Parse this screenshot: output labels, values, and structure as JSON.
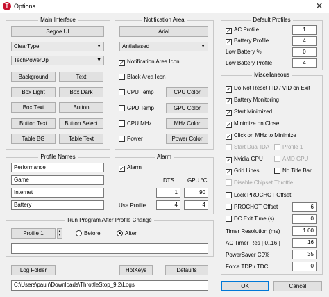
{
  "window": {
    "title": "Options",
    "app_icon_letter": "T",
    "close_glyph": "✕"
  },
  "groups": {
    "main_interface": "Main Interface",
    "notification_area": "Notification Area",
    "default_profiles": "Default Profiles",
    "profile_names": "Profile Names",
    "alarm": "Alarm",
    "run_program": "Run Program After Profile Change",
    "miscellaneous": "Miscellaneous"
  },
  "main_interface": {
    "font_button": "Segoe UI",
    "text_mode_select": "ClearType",
    "theme_select": "TechPowerUp",
    "color_buttons": [
      "Background",
      "Text",
      "Box Light",
      "Box Dark",
      "Box Text",
      "Button",
      "Button Text",
      "Button Select",
      "Table BG",
      "Table Text"
    ]
  },
  "notification_area": {
    "font_button": "Arial",
    "text_mode_select": "Antialiased",
    "notification_icon": {
      "label": "Notification Area Icon",
      "checked": true
    },
    "black_icon": {
      "label": "Black Area Icon",
      "checked": false
    },
    "rows": [
      {
        "label": "CPU Temp",
        "checked": false,
        "button": "CPU Color"
      },
      {
        "label": "GPU Temp",
        "checked": false,
        "button": "GPU Color"
      },
      {
        "label": "CPU MHz",
        "checked": false,
        "button": "MHz Color"
      },
      {
        "label": "Power",
        "checked": false,
        "button": "Power Color"
      }
    ]
  },
  "default_profiles": [
    {
      "label": "AC Profile",
      "type": "check",
      "checked": true,
      "value": "1"
    },
    {
      "label": "Battery Profile",
      "type": "check",
      "checked": true,
      "value": "4"
    },
    {
      "label": "Low Battery %",
      "type": "text",
      "value": "0"
    },
    {
      "label": "Low Battery Profile",
      "type": "text",
      "value": "4"
    }
  ],
  "profile_names": [
    "Performance",
    "Game",
    "Internet",
    "Battery"
  ],
  "alarm": {
    "label": "Alarm",
    "checked": true,
    "dts_header": "DTS",
    "gpu_header": "GPU °C",
    "dts_value": "1",
    "gpu_value": "90",
    "use_profile_label": "Use Profile",
    "use_profile_dts": "4",
    "use_profile_gpu": "4"
  },
  "run_program": {
    "profile_button": "Profile 1",
    "before_label": "Before",
    "after_label": "After",
    "selected": "after",
    "path_value": ""
  },
  "miscellaneous": {
    "checks": [
      {
        "label": "Do Not Reset FID / VID on Exit",
        "checked": true,
        "disabled": false
      },
      {
        "label": "Battery Monitoring",
        "checked": true,
        "disabled": false
      },
      {
        "label": "Start Minimized",
        "checked": true,
        "disabled": false
      },
      {
        "label": "Minimize on Close",
        "checked": true,
        "disabled": false
      },
      {
        "label": "Click on MHz to Minimize",
        "checked": true,
        "disabled": false
      }
    ],
    "pairs": [
      {
        "left": {
          "label": "Start Dual IDA",
          "checked": false,
          "disabled": true
        },
        "right": {
          "label": "Profile 1",
          "checked": false,
          "disabled": true
        }
      },
      {
        "left": {
          "label": "Nvidia GPU",
          "checked": true,
          "disabled": false
        },
        "right": {
          "label": "AMD GPU",
          "checked": false,
          "disabled": true
        }
      },
      {
        "left": {
          "label": "Grid Lines",
          "checked": true,
          "disabled": false
        },
        "right": {
          "label": "No Title Bar",
          "checked": false,
          "disabled": false
        }
      }
    ],
    "disable_chipset": {
      "label": "Disable Chipset Throttle",
      "checked": false,
      "disabled": true
    },
    "lock_prochot": {
      "label": "Lock PROCHOT Offset",
      "checked": false,
      "disabled": false
    },
    "prochot_offset": {
      "label": "PROCHOT Offset",
      "checked": false,
      "value": "6"
    },
    "dc_exit_time": {
      "label": "DC Exit Time (s)",
      "checked": false,
      "value": "0"
    },
    "timer_resolution": {
      "label": "Timer Resolution (ms)",
      "value": "1.00"
    },
    "ac_timer_res": {
      "label": "AC Timer Res [ 0..16 ]",
      "value": "16"
    },
    "powersaver": {
      "label": "PowerSaver C0%",
      "value": "35"
    },
    "force_tdp": {
      "label": "Force TDP / TDC",
      "value": "0"
    }
  },
  "footer": {
    "log_folder": "Log Folder",
    "hotkeys": "HotKeys",
    "defaults": "Defaults",
    "ok": "OK",
    "cancel": "Cancel",
    "log_path": "C:\\Users\\paulr\\Downloads\\ThrottleStop_9.2\\Logs"
  },
  "colors": {
    "accent": "#0078d7",
    "app_icon": "#c8102e",
    "background": "#f0f0f0"
  }
}
